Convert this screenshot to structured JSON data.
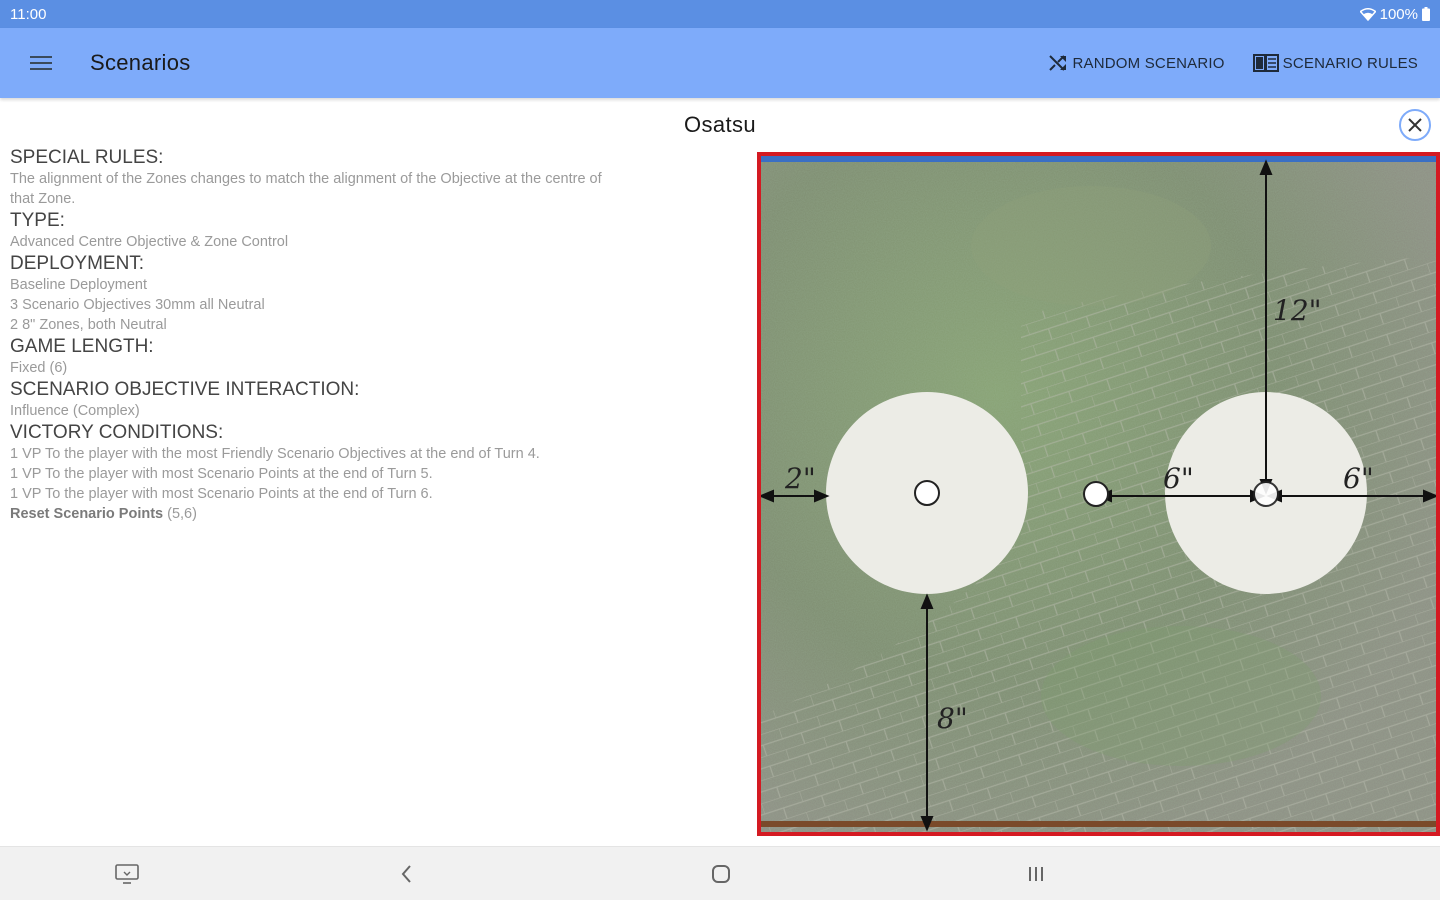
{
  "status_bar": {
    "time": "11:00",
    "battery": "100%"
  },
  "app_bar": {
    "title": "Scenarios",
    "random_label": "RANDOM SCENARIO",
    "rules_label": "SCENARIO RULES"
  },
  "scenario": {
    "name": "Osatsu",
    "sections": [
      {
        "heading": "SPECIAL RULES:",
        "lines": [
          "The alignment of the Zones changes to match the alignment of the Objective at the centre of",
          "that Zone."
        ]
      },
      {
        "heading": "TYPE:",
        "lines": [
          "Advanced Centre Objective & Zone Control"
        ]
      },
      {
        "heading": "DEPLOYMENT:",
        "lines": [
          "Baseline Deployment",
          "3 Scenario Objectives 30mm all Neutral",
          "2 8\" Zones, both Neutral"
        ]
      },
      {
        "heading": "GAME LENGTH:",
        "lines": [
          "Fixed (6)"
        ]
      },
      {
        "heading": "SCENARIO OBJECTIVE INTERACTION:",
        "lines": [
          "Influence (Complex)"
        ]
      },
      {
        "heading": "VICTORY CONDITIONS:",
        "lines": [
          "1 VP To the player with the most Friendly Scenario Objectives at the end of Turn 4.",
          "1 VP To the player with most Scenario Points at the end of Turn 5.",
          "1 VP To the player with most Scenario Points at the end of Turn 6."
        ]
      }
    ],
    "reset_label": "Reset Scenario Points",
    "reset_value": "(5,6)"
  },
  "map": {
    "labels": {
      "top": "12\"",
      "left": "2\"",
      "mid": "6\"",
      "right": "6\"",
      "bottom": "8\""
    },
    "colors": {
      "border": "#d41a22",
      "top_edge": "#3a6fc4",
      "bottom_edge": "#7a4a2a",
      "zone": "#ecece6"
    }
  }
}
